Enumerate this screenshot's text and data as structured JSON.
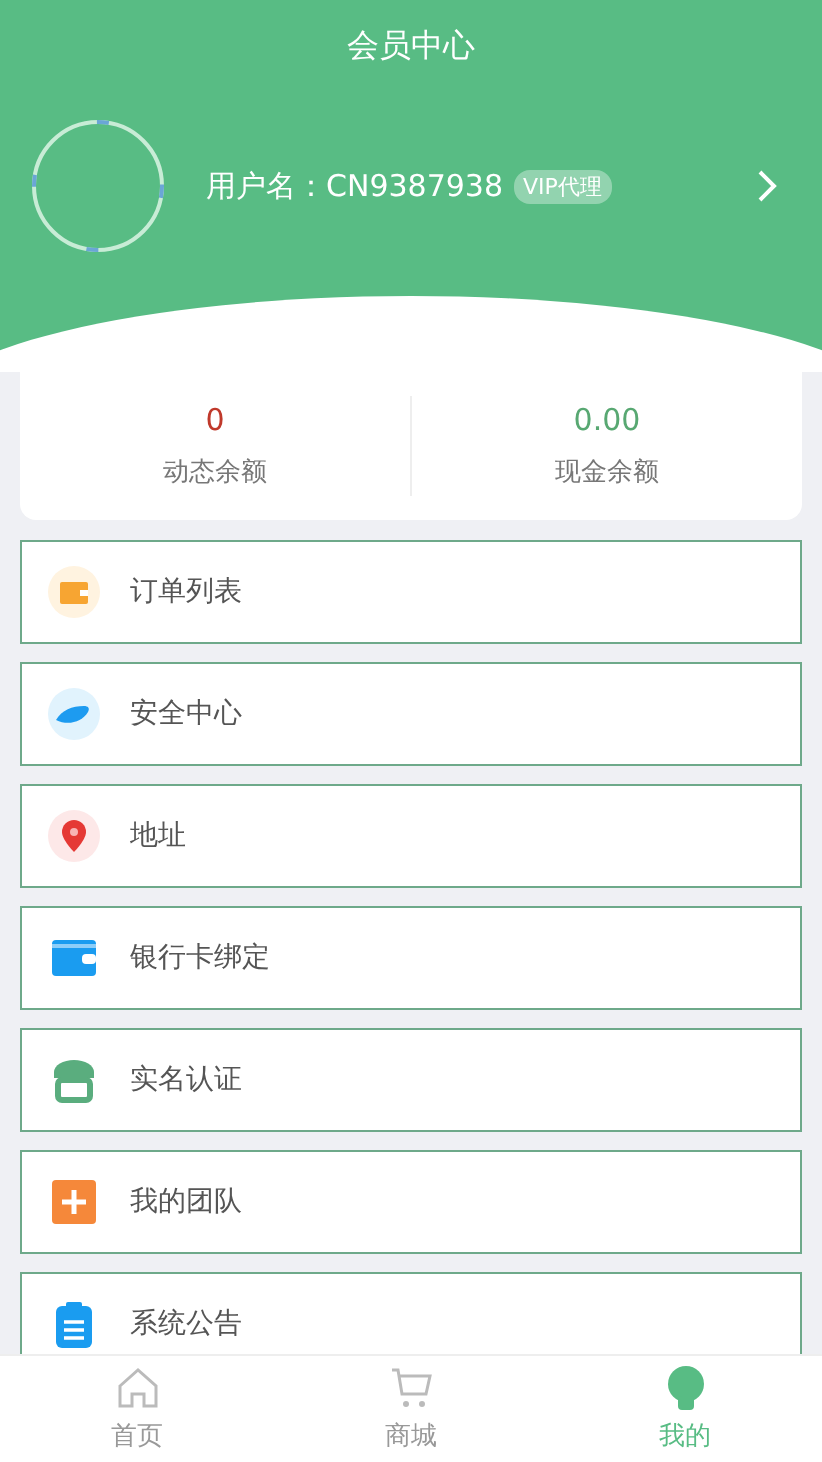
{
  "header": {
    "title": "会员中心"
  },
  "profile": {
    "username_label": "用户名：",
    "username": "CN9387938",
    "badge": "VIP代理"
  },
  "balances": [
    {
      "value": "0",
      "label": "动态余额",
      "kind": "dynamic"
    },
    {
      "value": "0.00",
      "label": "现金余额",
      "kind": "cash"
    }
  ],
  "menu": [
    {
      "label": "订单列表",
      "kind": "orders"
    },
    {
      "label": "安全中心",
      "kind": "security"
    },
    {
      "label": "地址",
      "kind": "address"
    },
    {
      "label": "银行卡绑定",
      "kind": "bankcard"
    },
    {
      "label": "实名认证",
      "kind": "verify"
    },
    {
      "label": "我的团队",
      "kind": "team"
    },
    {
      "label": "系统公告",
      "kind": "notice"
    }
  ],
  "tab_bar": [
    {
      "label": "首页",
      "kind": "home",
      "selected": false
    },
    {
      "label": "商城",
      "kind": "shop",
      "selected": false
    },
    {
      "label": "我的",
      "kind": "me",
      "selected": true
    }
  ]
}
